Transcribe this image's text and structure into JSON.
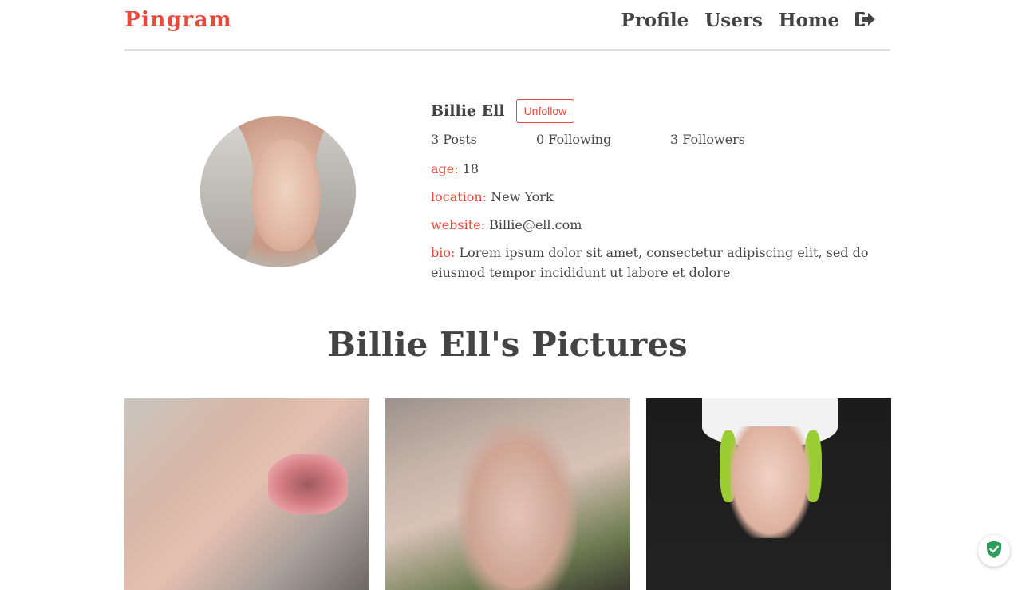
{
  "header": {
    "brand": "Pingram",
    "nav": [
      {
        "label": "Profile"
      },
      {
        "label": "Users"
      },
      {
        "label": "Home"
      }
    ],
    "logout_icon": "sign-out-icon"
  },
  "profile": {
    "name": "Billie Ell",
    "unfollow_label": "Unfollow",
    "stats": {
      "posts": "3 Posts",
      "following": "0 Following",
      "followers": "3 Followers"
    },
    "fields": [
      {
        "label": "age:",
        "value": "18"
      },
      {
        "label": "location:",
        "value": "New York"
      },
      {
        "label": "website:",
        "value": "Billie@ell.com"
      },
      {
        "label": "bio:",
        "value": "Lorem ipsum dolor sit amet, consectetur adipiscing elit, sed do eiusmod tempor incididunt ut labore et dolore"
      }
    ]
  },
  "pictures": {
    "title": "Billie Ell's Pictures",
    "count": 3
  },
  "colors": {
    "accent": "#e64a3c",
    "text": "#444444",
    "divider": "#dedede",
    "shield": "#2e9e5b"
  },
  "extension_badge_icon": "shield-check-icon"
}
